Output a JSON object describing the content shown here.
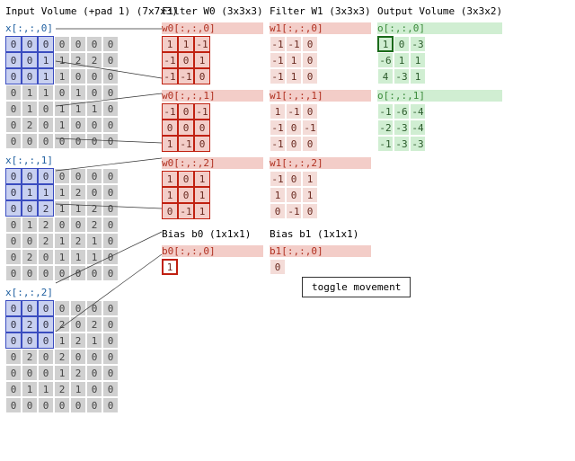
{
  "titles": {
    "input": "Input Volume (+pad 1) (7x7x3)",
    "w0": "Filter W0 (3x3x3)",
    "w1": "Filter W1 (3x3x3)",
    "out": "Output Volume (3x3x2)",
    "b0": "Bias b0 (1x1x1)",
    "b1": "Bias b1 (1x1x1)"
  },
  "labels": {
    "x0": "x[:,:,0]",
    "x1": "x[:,:,1]",
    "x2": "x[:,:,2]",
    "w00": "w0[:,:,0]",
    "w01": "w0[:,:,1]",
    "w02": "w0[:,:,2]",
    "w10": "w1[:,:,0]",
    "w11": "w1[:,:,1]",
    "w12": "w1[:,:,2]",
    "o0": "o[:,:,0]",
    "o1": "o[:,:,1]",
    "b00": "b0[:,:,0]",
    "b10": "b1[:,:,0]"
  },
  "button": "toggle movement",
  "b0": 1,
  "b1": 0,
  "chart_data": {
    "type": "table",
    "stride": 2,
    "padding": 1,
    "input": [
      [
        [
          0,
          0,
          0,
          0,
          0,
          0,
          0
        ],
        [
          0,
          0,
          1,
          1,
          2,
          2,
          0
        ],
        [
          0,
          0,
          1,
          1,
          0,
          0,
          0
        ],
        [
          0,
          1,
          1,
          0,
          1,
          0,
          0
        ],
        [
          0,
          1,
          0,
          1,
          1,
          1,
          0
        ],
        [
          0,
          2,
          0,
          1,
          0,
          0,
          0
        ],
        [
          0,
          0,
          0,
          0,
          0,
          0,
          0
        ]
      ],
      [
        [
          0,
          0,
          0,
          0,
          0,
          0,
          0
        ],
        [
          0,
          1,
          1,
          1,
          2,
          0,
          0
        ],
        [
          0,
          0,
          2,
          1,
          1,
          2,
          0
        ],
        [
          0,
          1,
          2,
          0,
          0,
          2,
          0
        ],
        [
          0,
          0,
          2,
          1,
          2,
          1,
          0
        ],
        [
          0,
          2,
          0,
          1,
          1,
          1,
          0
        ],
        [
          0,
          0,
          0,
          0,
          0,
          0,
          0
        ]
      ],
      [
        [
          0,
          0,
          0,
          0,
          0,
          0,
          0
        ],
        [
          0,
          2,
          0,
          2,
          0,
          2,
          0
        ],
        [
          0,
          0,
          0,
          1,
          2,
          1,
          0
        ],
        [
          0,
          2,
          0,
          2,
          0,
          0,
          0
        ],
        [
          0,
          0,
          0,
          1,
          2,
          0,
          0
        ],
        [
          0,
          1,
          1,
          2,
          1,
          0,
          0
        ],
        [
          0,
          0,
          0,
          0,
          0,
          0,
          0
        ]
      ]
    ],
    "w0": [
      [
        [
          1,
          1,
          -1
        ],
        [
          -1,
          0,
          1
        ],
        [
          -1,
          -1,
          0
        ]
      ],
      [
        [
          -1,
          0,
          -1
        ],
        [
          0,
          0,
          0
        ],
        [
          1,
          -1,
          0
        ]
      ],
      [
        [
          1,
          0,
          1
        ],
        [
          1,
          0,
          1
        ],
        [
          0,
          -1,
          1
        ]
      ]
    ],
    "w1": [
      [
        [
          -1,
          -1,
          0
        ],
        [
          -1,
          1,
          0
        ],
        [
          -1,
          1,
          0
        ]
      ],
      [
        [
          1,
          -1,
          0
        ],
        [
          -1,
          0,
          -1
        ],
        [
          -1,
          0,
          0
        ]
      ],
      [
        [
          -1,
          0,
          1
        ],
        [
          1,
          0,
          1
        ],
        [
          0,
          -1,
          0
        ]
      ]
    ],
    "output": [
      [
        [
          1,
          0,
          -3
        ],
        [
          -6,
          1,
          1
        ],
        [
          4,
          -3,
          1
        ]
      ],
      [
        [
          -1,
          -6,
          -4
        ],
        [
          -2,
          -3,
          -4
        ],
        [
          -1,
          -3,
          -3
        ]
      ]
    ]
  }
}
